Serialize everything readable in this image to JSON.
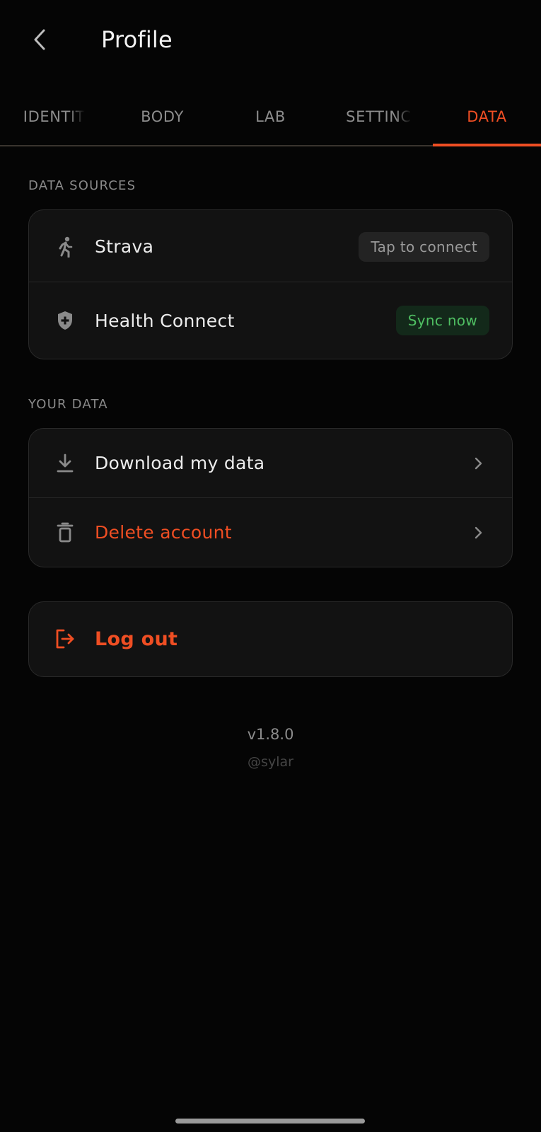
{
  "header": {
    "back_icon": "chevron-left-icon",
    "title": "Profile"
  },
  "tabs": [
    {
      "label": "IDENTIT",
      "active": false
    },
    {
      "label": "BODY",
      "active": false
    },
    {
      "label": "LAB",
      "active": false
    },
    {
      "label": "SETTINC",
      "active": false
    },
    {
      "label": "DATA",
      "active": true
    }
  ],
  "colors": {
    "accent": "#ef4e23",
    "success": "#4fbf62",
    "background": "#050505",
    "card": "#121212"
  },
  "data_sources": {
    "section_label": "DATA SOURCES",
    "items": [
      {
        "label": "Strava",
        "icon": "running-person-icon",
        "action_label": "Tap to connect",
        "action_style": "neutral"
      },
      {
        "label": "Health Connect",
        "icon": "shield-plus-icon",
        "action_label": "Sync now",
        "action_style": "success"
      }
    ]
  },
  "your_data": {
    "section_label": "YOUR DATA",
    "items": [
      {
        "label": "Download my data",
        "icon": "download-icon",
        "danger": false
      },
      {
        "label": "Delete account",
        "icon": "trash-icon",
        "danger": true
      }
    ]
  },
  "logout": {
    "label": "Log out",
    "icon": "logout-icon"
  },
  "footer": {
    "version": "v1.8.0",
    "handle": "@sylar"
  }
}
